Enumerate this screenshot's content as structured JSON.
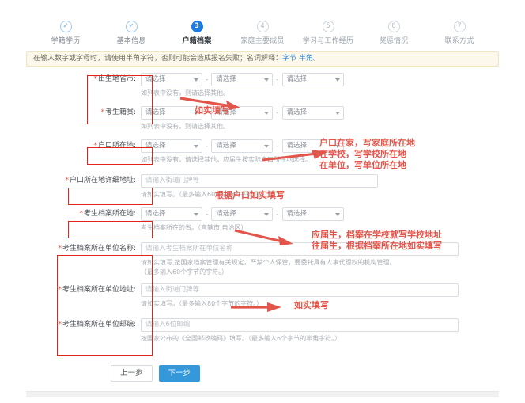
{
  "stepper": {
    "steps": [
      {
        "num": "1",
        "glyph": "✓",
        "label": "学籍学历",
        "state": "done"
      },
      {
        "num": "2",
        "glyph": "✓",
        "label": "基本信息",
        "state": "done"
      },
      {
        "num": "3",
        "glyph": "3",
        "label": "户籍档案",
        "state": "active"
      },
      {
        "num": "4",
        "glyph": "4",
        "label": "家庭主要成员",
        "state": "todo"
      },
      {
        "num": "5",
        "glyph": "5",
        "label": "学习与工作经历",
        "state": "todo"
      },
      {
        "num": "6",
        "glyph": "6",
        "label": "奖惩情况",
        "state": "todo"
      },
      {
        "num": "7",
        "glyph": "7",
        "label": "联系方式",
        "state": "todo"
      }
    ]
  },
  "alert": {
    "text_before": "在输入数字或字母时，请使用半角字符，否则可能会造成报名失败；名词解释：",
    "link1": "字节",
    "link2": "半角",
    "text_after": "。"
  },
  "select_placeholder": "请选择",
  "dash": "-",
  "fields": {
    "birthplace": {
      "label": "出生地省市:",
      "hint": "如列表中没有，则请选择其他。"
    },
    "native_place": {
      "label": "考生籍贯:",
      "hint": "如列表中没有，则请选择其他。"
    },
    "hukou_location": {
      "label": "户口所在地:",
      "hint": "如列表中没有，请选择其他，应届生按实际户口所在地选择。"
    },
    "hukou_address": {
      "label": "户口所在地详细地址:",
      "placeholder": "请输入街道门牌等",
      "hint": "请如实填写。（最多输入60个字节的字符。）"
    },
    "archive_location": {
      "label": "考生档案所在地:",
      "hint": "考生档案所在的省。（直辖市,自治区）"
    },
    "archive_unit_name": {
      "label": "考生档案所在单位名称:",
      "placeholder": "请输入考生档案所在单位名称",
      "hint_line1": "请如实填写,按国家档案管理有关规定，严禁个人保管，要委托具有人事代理权的机构管理。",
      "hint_line2": "（最多输入60个字节的字符。）"
    },
    "archive_unit_address": {
      "label": "考生档案所在单位地址:",
      "placeholder": "请输入街道门牌等",
      "hint": "请如实填写。（最多输入80个字节的字符。）"
    },
    "archive_unit_zip": {
      "label": "考生档案所在单位邮编:",
      "placeholder": "请输入6位邮编",
      "hint": "按国家公布的《全国邮政编码》填写。（最多输入6个字节的半角字符。）"
    }
  },
  "annotations": {
    "a1": "如实填写",
    "a2": "户口在家，写家庭所在地\n在学校，写学校所在地\n在单位，写单位所在地",
    "a3": "根据户口如实填写",
    "a4": "应届生，档案在学校就写学校地址\n往届生，根据档案所在地如实填写",
    "a5": "如实填写"
  },
  "buttons": {
    "prev": "上一步",
    "next": "下一步"
  },
  "colors": {
    "accent": "#1b7ae4",
    "next_button": "#3498db",
    "annotation_red": "#e2554b",
    "highlight_box": "#e2221b",
    "required_star": "#e8584c",
    "alert_bg": "#fdf8ec"
  }
}
